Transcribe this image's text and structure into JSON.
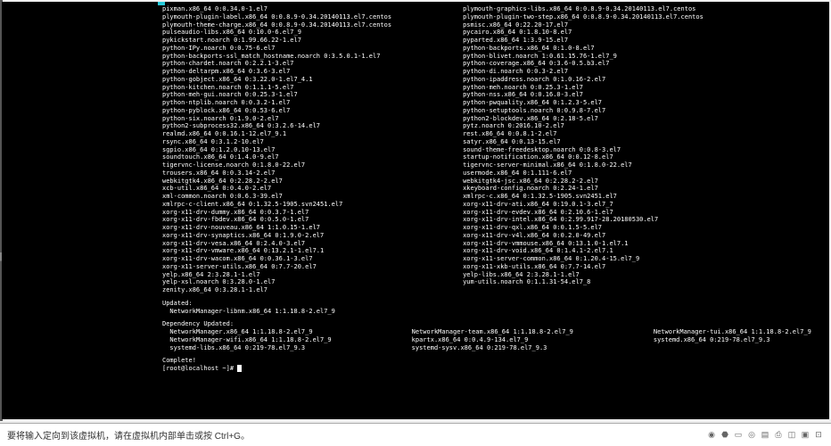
{
  "packages": {
    "left": [
      "pixman.x86_64 0:0.34.0-1.el7",
      "plymouth-plugin-label.x86_64 0:0.8.9-0.34.20140113.el7.centos",
      "plymouth-theme-charge.x86_64 0:0.8.9-0.34.20140113.el7.centos",
      "pulseaudio-libs.x86_64 0:10.0-6.el7_9",
      "pykickstart.noarch 0:1.99.66.22-1.el7",
      "python-IPy.noarch 0:0.75-6.el7",
      "python-backports-ssl_match_hostname.noarch 0:3.5.0.1-1.el7",
      "python-chardet.noarch 0:2.2.1-3.el7",
      "python-deltarpm.x86_64 0:3.6-3.el7",
      "python-gobject.x86_64 0:3.22.0-1.el7_4.1",
      "python-kitchen.noarch 0:1.1.1-5.el7",
      "python-meh-gui.noarch 0:0.25.3-1.el7",
      "python-ntplib.noarch 0:0.3.2-1.el7",
      "python-pyblock.x86_64 0:0.53-6.el7",
      "python-six.noarch 0:1.9.0-2.el7",
      "python2-subprocess32.x86_64 0:3.2.6-14.el7",
      "realmd.x86_64 0:0.16.1-12.el7_9.1",
      "rsync.x86_64 0:3.1.2-10.el7",
      "sgpio.x86_64 0:1.2.0.10-13.el7",
      "soundtouch.x86_64 0:1.4.0-9.el7",
      "tigervnc-license.noarch 0:1.8.0-22.el7",
      "trousers.x86_64 0:0.3.14-2.el7",
      "webkitgtk4.x86_64 0:2.28.2-2.el7",
      "xcb-util.x86_64 0:0.4.0-2.el7",
      "xml-common.noarch 0:0.6.3-39.el7",
      "xmlrpc-c-client.x86_64 0:1.32.5-1905.svn2451.el7",
      "xorg-x11-drv-dummy.x86_64 0:0.3.7-1.el7",
      "xorg-x11-drv-fbdev.x86_64 0:0.5.0-1.el7",
      "xorg-x11-drv-nouveau.x86_64 1:1.0.15-1.el7",
      "xorg-x11-drv-synaptics.x86_64 0:1.9.0-2.el7",
      "xorg-x11-drv-vesa.x86_64 0:2.4.0-3.el7",
      "xorg-x11-drv-vmware.x86_64 0:13.2.1-1.el7.1",
      "xorg-x11-drv-wacom.x86_64 0:0.36.1-3.el7",
      "xorg-x11-server-utils.x86_64 0:7.7-20.el7",
      "yelp.x86_64 2:3.28.1-1.el7",
      "yelp-xsl.noarch 0:3.28.0-1.el7",
      "zenity.x86_64 0:3.28.1-1.el7"
    ],
    "right": [
      "plymouth-graphics-libs.x86_64 0:0.8.9-0.34.20140113.el7.centos",
      "plymouth-plugin-two-step.x86_64 0:0.8.9-0.34.20140113.el7.centos",
      "psmisc.x86_64 0:22.20-17.el7",
      "pycairo.x86_64 0:1.8.10-8.el7",
      "pyparted.x86_64 1:3.9-15.el7",
      "python-backports.x86_64 0:1.0-8.el7",
      "python-blivet.noarch 1:0.61.15.76-1.el7_9",
      "python-coverage.x86_64 0:3.6-0.5.b3.el7",
      "python-di.noarch 0:0.3-2.el7",
      "python-ipaddress.noarch 0:1.0.16-2.el7",
      "python-meh.noarch 0:0.25.3-1.el7",
      "python-nss.x86_64 0:0.16.0-3.el7",
      "python-pwquality.x86_64 0:1.2.3-5.el7",
      "python-setuptools.noarch 0:0.9.8-7.el7",
      "python2-blockdev.x86_64 0:2.18-5.el7",
      "pytz.noarch 0:2016.10-2.el7",
      "rest.x86_64 0:0.8.1-2.el7",
      "satyr.x86_64 0:0.13-15.el7",
      "sound-theme-freedesktop.noarch 0:0.8-3.el7",
      "startup-notification.x86_64 0:0.12-8.el7",
      "tigervnc-server-minimal.x86_64 0:1.8.0-22.el7",
      "usermode.x86_64 0:1.111-6.el7",
      "webkitgtk4-jsc.x86_64 0:2.28.2-2.el7",
      "xkeyboard-config.noarch 0:2.24-1.el7",
      "xmlrpc-c.x86_64 0:1.32.5-1905.svn2451.el7",
      "xorg-x11-drv-ati.x86_64 0:19.0.1-3.el7_7",
      "xorg-x11-drv-evdev.x86_64 0:2.10.6-1.el7",
      "xorg-x11-drv-intel.x86_64 0:2.99.917-28.20180530.el7",
      "xorg-x11-drv-qxl.x86_64 0:0.1.5-5.el7",
      "xorg-x11-drv-v4l.x86_64 0:0.2.0-49.el7",
      "xorg-x11-drv-vmmouse.x86_64 0:13.1.0-1.el7.1",
      "xorg-x11-drv-void.x86_64 0:1.4.1-2.el7.1",
      "xorg-x11-server-common.x86_64 0:1.20.4-15.el7_9",
      "xorg-x11-xkb-utils.x86_64 0:7.7-14.el7",
      "yelp-libs.x86_64 2:3.28.1-1.el7",
      "yum-utils.noarch 0:1.1.31-54.el7_8"
    ]
  },
  "sections": {
    "updated": "Updated:",
    "updated_item": "  NetworkManager-libnm.x86_64 1:1.18.8-2.el7_9",
    "dep_updated": "Dependency Updated:",
    "complete": "Complete!"
  },
  "dep": {
    "col1": [
      "  NetworkManager.x86_64 1:1.18.8-2.el7_9",
      "  NetworkManager-wifi.x86_64 1:1.18.8-2.el7_9",
      "  systemd-libs.x86_64 0:219-78.el7_9.3"
    ],
    "col2": [
      "NetworkManager-team.x86_64 1:1.18.8-2.el7_9",
      "kpartx.x86_64 0:0.4.9-134.el7_9",
      "systemd-sysv.x86_64 0:219-78.el7_9.3"
    ],
    "col3": [
      "NetworkManager-tui.x86_64 1:1.18.8-2.el7_9",
      "systemd.x86_64 0:219-78.el7_9.3"
    ]
  },
  "prompt": "[root@localhost ~]#",
  "status_text": "要将输入定向到该虚拟机，请在虚拟机内部单击或按 Ctrl+G。"
}
